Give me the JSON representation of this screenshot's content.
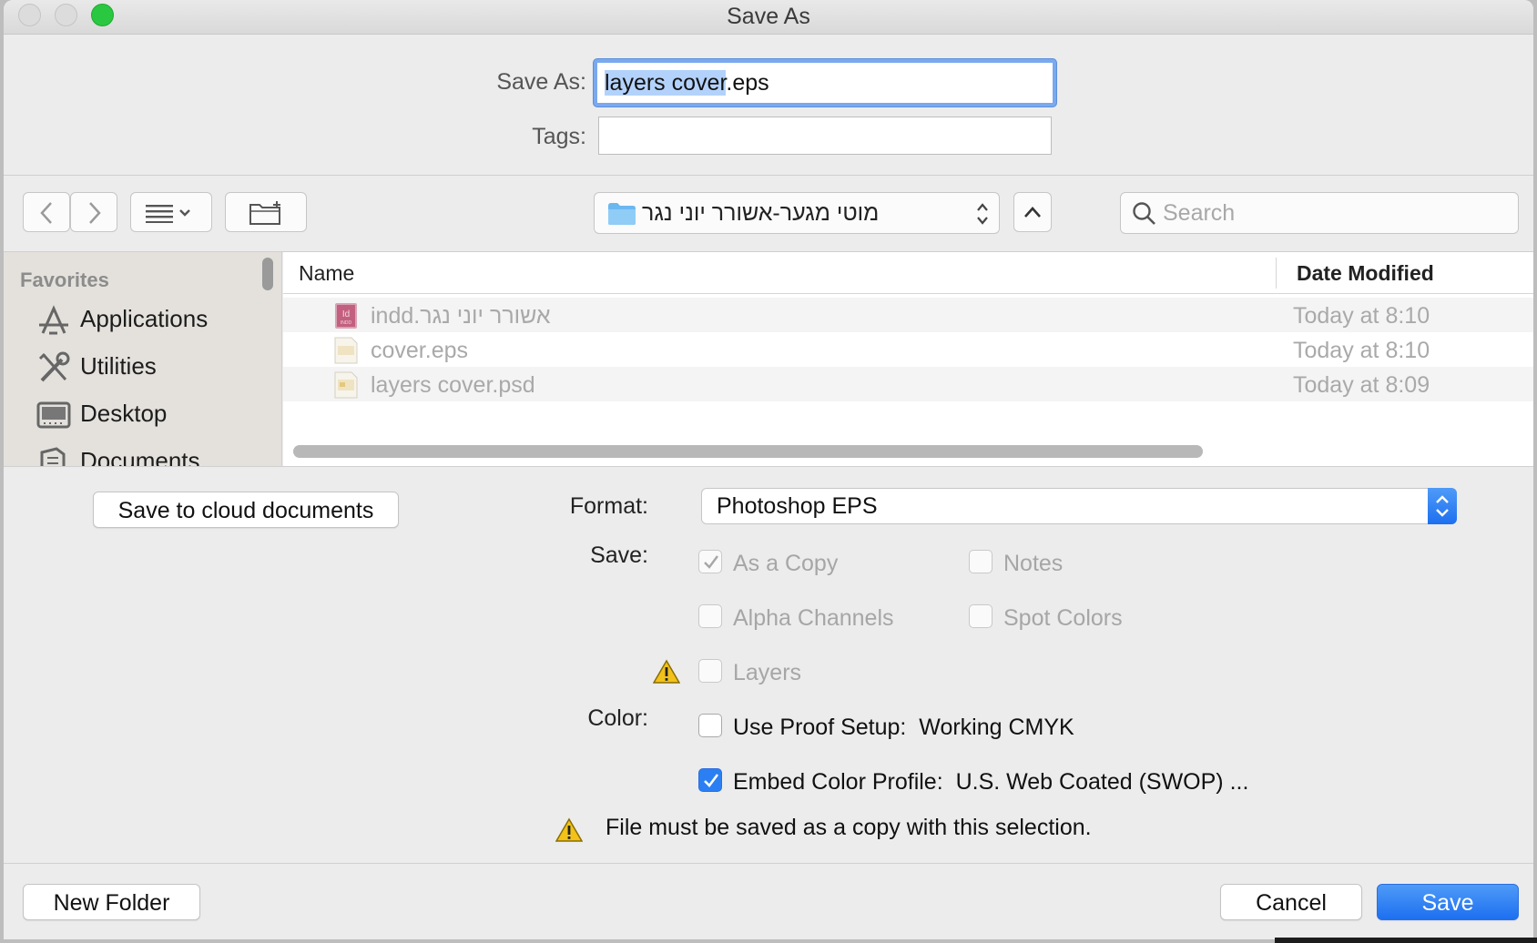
{
  "window": {
    "title": "Save As"
  },
  "save_as": {
    "label": "Save As:",
    "filename_selected": "layers cover",
    "filename_ext": ".eps"
  },
  "tags": {
    "label": "Tags:",
    "value": ""
  },
  "toolbar": {
    "path_folder": "מוטי מגער-אשורר יוני נגר",
    "search_placeholder": "Search"
  },
  "sidebar": {
    "heading": "Favorites",
    "items": [
      {
        "label": "Applications",
        "icon": "applications-icon"
      },
      {
        "label": "Utilities",
        "icon": "utilities-icon"
      },
      {
        "label": "Desktop",
        "icon": "desktop-icon"
      },
      {
        "label": "Documents",
        "icon": "documents-icon"
      }
    ]
  },
  "files": {
    "columns": {
      "name": "Name",
      "date": "Date Modified"
    },
    "rows": [
      {
        "name": "אשורר יוני נגר.indd",
        "date": "Today at 8:10",
        "icon": "indesign-file-icon"
      },
      {
        "name": "cover.eps",
        "date": "Today at 8:10",
        "icon": "eps-file-icon"
      },
      {
        "name": "layers cover.psd",
        "date": "Today at 8:09",
        "icon": "psd-file-icon"
      }
    ]
  },
  "options": {
    "cloud_button": "Save to cloud documents",
    "format_label": "Format:",
    "format_value": "Photoshop EPS",
    "save_label": "Save:",
    "as_a_copy": "As a Copy",
    "notes": "Notes",
    "alpha_channels": "Alpha Channels",
    "spot_colors": "Spot Colors",
    "layers": "Layers",
    "color_label": "Color:",
    "use_proof_setup": "Use Proof Setup:",
    "proof_setup_value": "Working CMYK",
    "embed_color_profile": "Embed Color Profile:",
    "embed_profile_value": "U.S. Web Coated (SWOP) ...",
    "warning": "File must be saved as a copy with this selection."
  },
  "footer": {
    "new_folder": "New Folder",
    "cancel": "Cancel",
    "save": "Save"
  },
  "colors": {
    "accent": "#1d6ff0",
    "warning": "#f2c21b"
  }
}
